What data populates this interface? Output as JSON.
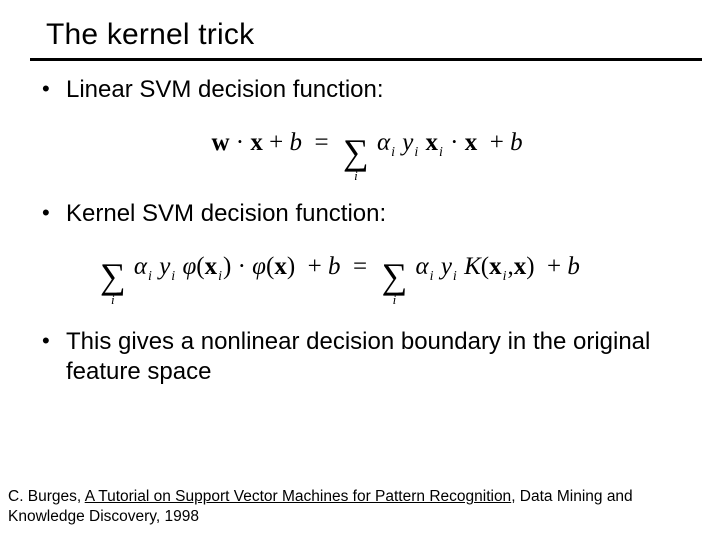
{
  "title": "The kernel trick",
  "bullets": {
    "b1": "Linear SVM decision function:",
    "b2": "Kernel SVM decision function:",
    "b3": "This gives a nonlinear decision boundary in the original feature space"
  },
  "equations": {
    "eq1": {
      "lhs_w": "w",
      "dot1": "·",
      "lhs_x": "x",
      "plus1": "+",
      "b1": "b",
      "eq": "=",
      "sigma_i": "i",
      "alpha": "α",
      "sub_i": "i",
      "y": "y",
      "xi": "x",
      "dot2": "·",
      "x2": "x",
      "plus2": "+",
      "b2": "b"
    },
    "eq2": {
      "sigma_i1": "i",
      "alpha1": "α",
      "ai1": "i",
      "y1": "y",
      "yi1": "i",
      "phi1": "φ",
      "lp1": "(",
      "xi1": "x",
      "xis1": "i",
      "rp1": ")",
      "dot": "·",
      "phi2": "φ",
      "lp2": "(",
      "x2": "x",
      "rp2": ")",
      "plus1": "+",
      "b1": "b",
      "eq": "=",
      "sigma_i2": "i",
      "alpha2": "α",
      "ai2": "i",
      "y2": "y",
      "yi2": "i",
      "K": "K",
      "lpK": "(",
      "xk1": "x",
      "xks1": "i",
      "comma": ",",
      "xk2": "x",
      "rpK": ")",
      "plus2": "+",
      "b2": "b"
    }
  },
  "footer": {
    "author": "C. Burges, ",
    "linktext": "A Tutorial on Support Vector Machines for Pattern Recognition",
    "tail": ",  Data Mining and Knowledge Discovery, 1998"
  }
}
